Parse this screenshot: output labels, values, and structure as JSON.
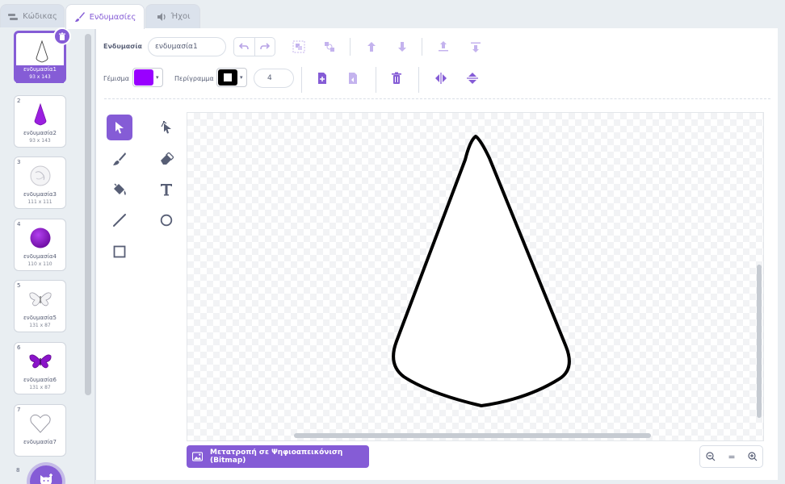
{
  "tabs": [
    {
      "label": "Κώδικας",
      "icon": "code-icon"
    },
    {
      "label": "Ενδυμασίες",
      "icon": "brush-icon",
      "active": true
    },
    {
      "label": "Ήχοι",
      "icon": "speaker-icon"
    }
  ],
  "costumes": [
    {
      "num": "1",
      "name": "ενδυμασία1",
      "size": "93 x 143",
      "selected": true
    },
    {
      "num": "2",
      "name": "ενδυμασία2",
      "size": "93 x 143"
    },
    {
      "num": "3",
      "name": "ενδυμασία3",
      "size": "111 x 111"
    },
    {
      "num": "4",
      "name": "ενδυμασία4",
      "size": "110 x 110"
    },
    {
      "num": "5",
      "name": "ενδυμασία5",
      "size": "131 x 87"
    },
    {
      "num": "6",
      "name": "ενδυμασία6",
      "size": "131 x 87"
    },
    {
      "num": "7",
      "name": "ενδυμασία7",
      "size": ""
    },
    {
      "num": "8",
      "name": "",
      "size": ""
    }
  ],
  "editor": {
    "costume_label": "Ενδυμασία",
    "costume_name": "ενδυμασία1",
    "fill_label": "Γέμισμα",
    "fill_color": "#9900ff",
    "outline_label": "Περίγραμμα",
    "outline_color": "#000000",
    "outline_width": "4",
    "convert_button": "Μετατροπή σε Ψηφιοαπεικόνιση (Bitmap)",
    "zoom_reset": "="
  },
  "colors": {
    "accent": "#855cd6",
    "toolbar_icon": "#855cd6"
  }
}
